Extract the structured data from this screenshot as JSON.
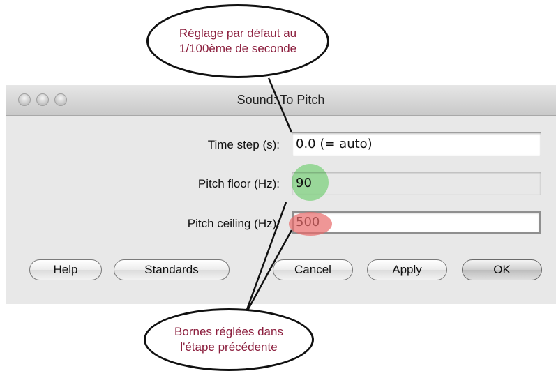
{
  "window": {
    "title": "Sound: To Pitch"
  },
  "fields": {
    "time_step": {
      "label": "Time step (s):",
      "value": "0.0 (= auto)"
    },
    "pitch_floor": {
      "label": "Pitch floor (Hz):",
      "value": "90"
    },
    "pitch_ceiling": {
      "label": "Pitch ceiling (Hz):",
      "value": "500"
    }
  },
  "buttons": {
    "help": "Help",
    "standards": "Standards",
    "cancel": "Cancel",
    "apply": "Apply",
    "ok": "OK"
  },
  "annotations": {
    "top": "Réglage par défaut au\n1/100ème de seconde",
    "bottom": "Bornes réglées dans\nl'étape précédente"
  },
  "colors": {
    "annotation_text": "#8c1f3e",
    "highlight_floor": "#7fd17f",
    "highlight_ceiling": "#e86a6a"
  }
}
